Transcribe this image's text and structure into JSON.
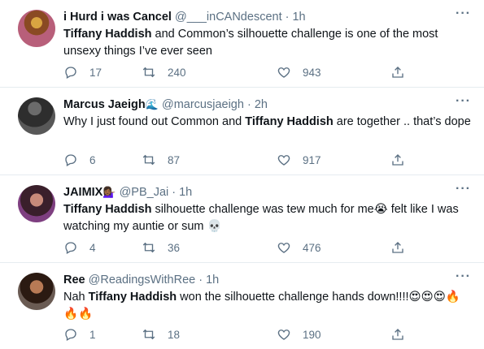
{
  "tweets": [
    {
      "name": "i Hurd i was Cancel",
      "name_emoji": "",
      "handle": "@___inCANdescent",
      "time": "· 1h",
      "body_parts": [
        {
          "text": "Tiffany Haddish",
          "bold": true
        },
        {
          "text": " and Common’s silhouette challenge is one of the most unsexy things I’ve ever seen",
          "bold": false
        }
      ],
      "replies": "17",
      "retweets": "240",
      "likes": "943"
    },
    {
      "name": "Marcus Jaeigh",
      "name_emoji": "🌊",
      "handle": "@marcusjaeigh",
      "time": "· 2h",
      "body_parts": [
        {
          "text": "Why I just found out Common and ",
          "bold": false
        },
        {
          "text": "Tiffany Haddish",
          "bold": true
        },
        {
          "text": " are together .. that’s dope",
          "bold": false
        }
      ],
      "replies": "6",
      "retweets": "87",
      "likes": "917"
    },
    {
      "name": "JAIMIX",
      "name_emoji": "💁🏾‍♀️",
      "handle": "@PB_Jai",
      "time": "· 1h",
      "body_parts": [
        {
          "text": "Tiffany Haddish",
          "bold": true
        },
        {
          "text": "  silhouette challenge was tew much for me😭 felt like I was watching my auntie or sum 💀",
          "bold": false
        }
      ],
      "replies": "4",
      "retweets": "36",
      "likes": "476"
    },
    {
      "name": "Ree",
      "name_emoji": "",
      "handle": "@ReadingsWithRee",
      "time": "· 1h",
      "body_parts": [
        {
          "text": "Nah ",
          "bold": false
        },
        {
          "text": "Tiffany Haddish",
          "bold": true
        },
        {
          "text": " won the silhouette challenge hands down!!!!😍😍😍🔥🔥🔥",
          "bold": false
        }
      ],
      "replies": "1",
      "retweets": "18",
      "likes": "190"
    }
  ],
  "more_label": "···",
  "icons": {
    "reply": "reply-icon",
    "retweet": "retweet-icon",
    "like": "heart-icon",
    "share": "share-icon"
  },
  "colors": {
    "text": "#0f1419",
    "muted": "#5b7083",
    "divider": "#e6ecf0"
  }
}
